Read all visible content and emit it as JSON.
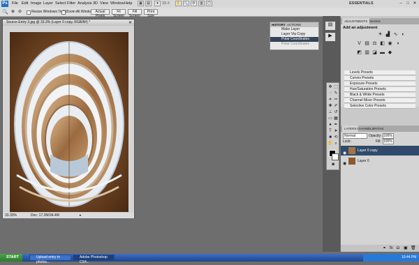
{
  "menubar": {
    "logo": "Ps",
    "items": [
      "File",
      "Edit",
      "Image",
      "Layer",
      "Select",
      "Filter",
      "Analysis",
      "3D",
      "View",
      "Window",
      "Help"
    ],
    "zoom": "33.3",
    "essentials": "ESSENTIALS",
    "window_controls": [
      "–",
      "□",
      "✕"
    ]
  },
  "options": {
    "resize_windows": "Resize Windows To Fit",
    "zoom_all": "Zoom All Windows",
    "actual_pixels": "Actual Pixels",
    "fit_screen": "Fit Screen",
    "fill_screen": "Fill Screen",
    "print_size": "Print Size"
  },
  "document": {
    "title": "Source Entry 3.jpg @ 33.3% (Layer 0 copy, RGB/8#) *",
    "zoom_readout": "33.33%",
    "doc_info": "Doc: 17.2M/34.4M"
  },
  "history": {
    "tabs": [
      "HISTORY",
      "ACTIONS"
    ],
    "items": [
      "Make Layer",
      "Layer Via Copy",
      "Polar Coordinates",
      "Polar Coordinates"
    ],
    "selected_index": 2
  },
  "adjustments": {
    "tabs": [
      "ADJUSTMENTS",
      "MASKS"
    ],
    "heading": "Add an adjustment",
    "presets": [
      "Levels Presets",
      "Curves Presets",
      "Exposure Presets",
      "Hue/Saturation Presets",
      "Black & White Presets",
      "Channel Mixer Presets",
      "Selective Color Presets"
    ]
  },
  "layers": {
    "tabs": [
      "LAYERS",
      "CHANNELS",
      "PATHS"
    ],
    "blend_mode": "Normal",
    "opacity_label": "Opacity:",
    "opacity": "100%",
    "lock_label": "Lock:",
    "fill_label": "Fill:",
    "fill": "100%",
    "items": [
      "Layer 0 copy",
      "Layer 0"
    ],
    "selected_index": 0
  },
  "taskbar": {
    "start": "START",
    "tasks": [
      "Upload entry to photos...",
      "Adobe Photoshop CS4..."
    ],
    "clock": "10:44 PM"
  },
  "colors": {
    "accent": "#2f4a6a",
    "selection": "#34455a",
    "workspace": "#6e6e6e"
  }
}
